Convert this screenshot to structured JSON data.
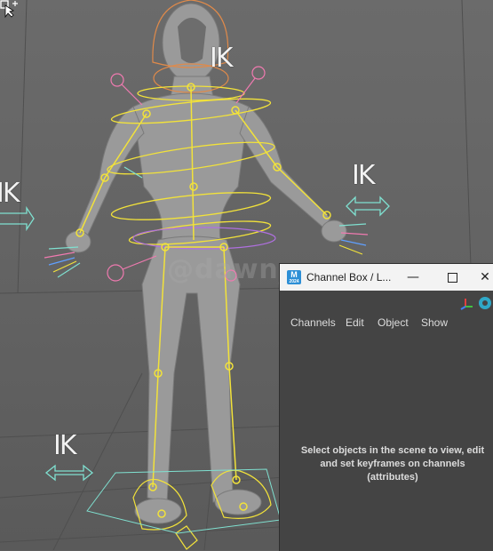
{
  "viewport": {
    "watermark": "@dawn_",
    "ik_labels": [
      "IK",
      "IK",
      "IK",
      "IK"
    ]
  },
  "panel": {
    "title": "Channel Box / L...",
    "app_icon": "M",
    "app_icon_sub": "2024",
    "buttons": {
      "minimize": "—",
      "close": "✕"
    },
    "menu": [
      "Channels",
      "Edit",
      "Object",
      "Show"
    ],
    "empty_message": "Select objects in the scene to view, edit and set keyframes on channels (attributes)"
  },
  "colors": {
    "bone": "#f2e23a",
    "ik_handle": "#7fe0d0",
    "pink_control": "#f07ab0",
    "panel_bg": "#444444",
    "titlebar_bg": "#f3f3f3"
  }
}
